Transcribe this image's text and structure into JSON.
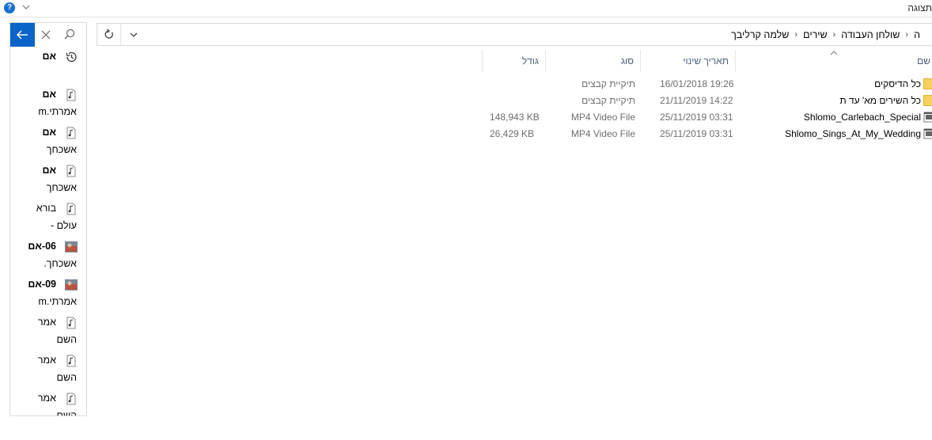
{
  "top": {
    "view_tab": "תצוגה",
    "help_label": "?"
  },
  "results_pane": {
    "items": [
      {
        "line1": "אם",
        "line2": "",
        "icon": "history-icon",
        "bold": true
      },
      {
        "line1": "אם",
        "line2": "אמרתי.m",
        "icon": "audio-file-icon",
        "bold": true
      },
      {
        "line1": "אם",
        "line2": "אשכחך",
        "icon": "audio-file-icon",
        "bold": true
      },
      {
        "line1": "אם",
        "line2": "אשכחך",
        "icon": "audio-file-icon",
        "bold": true
      },
      {
        "line1": "בורא",
        "line2": "עולם -",
        "icon": "audio-file-icon",
        "bold": false
      },
      {
        "line1": "06-אם",
        "line2": "אשכחך.",
        "icon": "album-art-icon",
        "bold": true
      },
      {
        "line1": "09-אם",
        "line2": "אמרתי.m",
        "icon": "album-art-icon",
        "bold": true
      },
      {
        "line1": "אמר",
        "line2": "השם",
        "icon": "audio-file-icon",
        "bold": false
      },
      {
        "line1": "אמר",
        "line2": "השם",
        "icon": "audio-file-icon",
        "bold": false
      },
      {
        "line1": "אמר",
        "line2": "השם",
        "icon": "audio-file-icon",
        "bold": false
      }
    ]
  },
  "address_bar": {
    "crumbs": [
      "ה",
      "שולחן העבודה",
      "שירים",
      "שלמה קרליבך"
    ]
  },
  "columns": {
    "name": "שם",
    "modified": "תאריך שינוי",
    "type": "סוג",
    "size": "גודל"
  },
  "files": [
    {
      "name": "כל הדיסקים",
      "modified": "16/01/2018 19:26",
      "type": "תיקיית קבצים",
      "size": "",
      "icon": "folder-icon"
    },
    {
      "name": "כל השירים מא' עד ת",
      "modified": "21/11/2019 14:22",
      "type": "תיקיית קבצים",
      "size": "",
      "icon": "folder-icon"
    },
    {
      "name": "Shlomo_Carlebach_Special",
      "modified": "25/11/2019 03:31",
      "type": "MP4 Video File",
      "size": "148,943 KB",
      "icon": "video-file-icon"
    },
    {
      "name": "Shlomo_Sings_At_My_Wedding",
      "modified": "25/11/2019 03:31",
      "type": "MP4 Video File",
      "size": "26,429 KB",
      "icon": "video-file-icon"
    }
  ],
  "colors": {
    "accent": "#0a64c8",
    "folder": "#f6d05e",
    "header_text": "#4c607a"
  }
}
